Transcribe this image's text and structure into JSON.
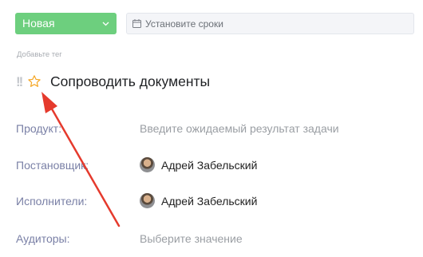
{
  "header": {
    "status_value": "Новая",
    "deadline_placeholder": "Установите сроки"
  },
  "tags": {
    "add_tag_hint": "Добавьте тег"
  },
  "task": {
    "priority_marks": "!!",
    "title": "Сопроводить документы"
  },
  "fields": {
    "product": {
      "label": "Продукт:",
      "placeholder": "Введите ожидаемый результат задачи"
    },
    "creator": {
      "label": "Постановщик:",
      "user_name": "Адрей Забельский"
    },
    "assignees": {
      "label": "Исполнители:",
      "user_name": "Адрей Забельский"
    },
    "auditors": {
      "label": "Аудиторы:",
      "placeholder": "Выберите значение"
    }
  },
  "colors": {
    "status_green": "#6dcf7e",
    "label_color": "#7a80a6",
    "star_orange": "#f5a623",
    "annotation_arrow": "#e53a2d"
  },
  "icons": [
    "chevron-down-icon",
    "calendar-icon",
    "star-icon",
    "avatar"
  ]
}
